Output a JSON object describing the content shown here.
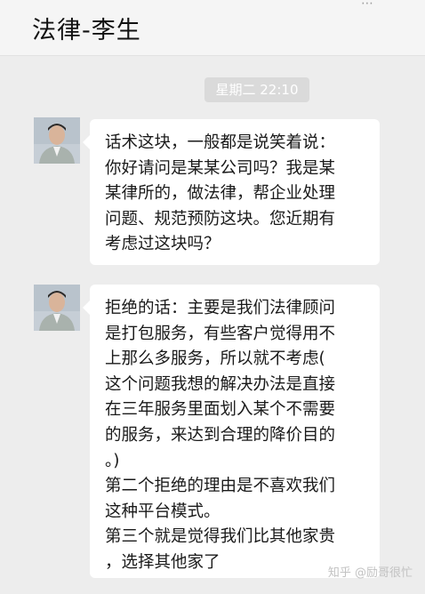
{
  "header": {
    "title": "法律-李生",
    "more_icon": "more-dots-icon"
  },
  "timestamp": "星期二 22:10",
  "messages": [
    {
      "avatar_icon": "contact-avatar",
      "lines": [
        "话术这块，一般都是说笑着说：",
        "你好请问是某某公司吗？我是某",
        "某律所的，做法律，帮企业处理",
        "问题、规范预防这块。您近期有",
        "考虑过这块吗？"
      ]
    },
    {
      "avatar_icon": "contact-avatar",
      "lines": [
        "拒绝的话：主要是我们法律顾问",
        "是打包服务，有些客户觉得用不",
        "上那么多服务，所以就不考虑(",
        "这个问题我想的解决办法是直接",
        "在三年服务里面划入某个不需要",
        "的服务，来达到合理的降价目的",
        "。)",
        "第二个拒绝的理由是不喜欢我们",
        "这种平台模式。",
        "第三个就是觉得我们比其他家贵",
        "，选择其他家了"
      ]
    }
  ],
  "watermark": "知乎 @励哥很忙",
  "colors": {
    "background": "#ededed",
    "bubble": "#ffffff",
    "timestamp_bg": "#dadada"
  }
}
